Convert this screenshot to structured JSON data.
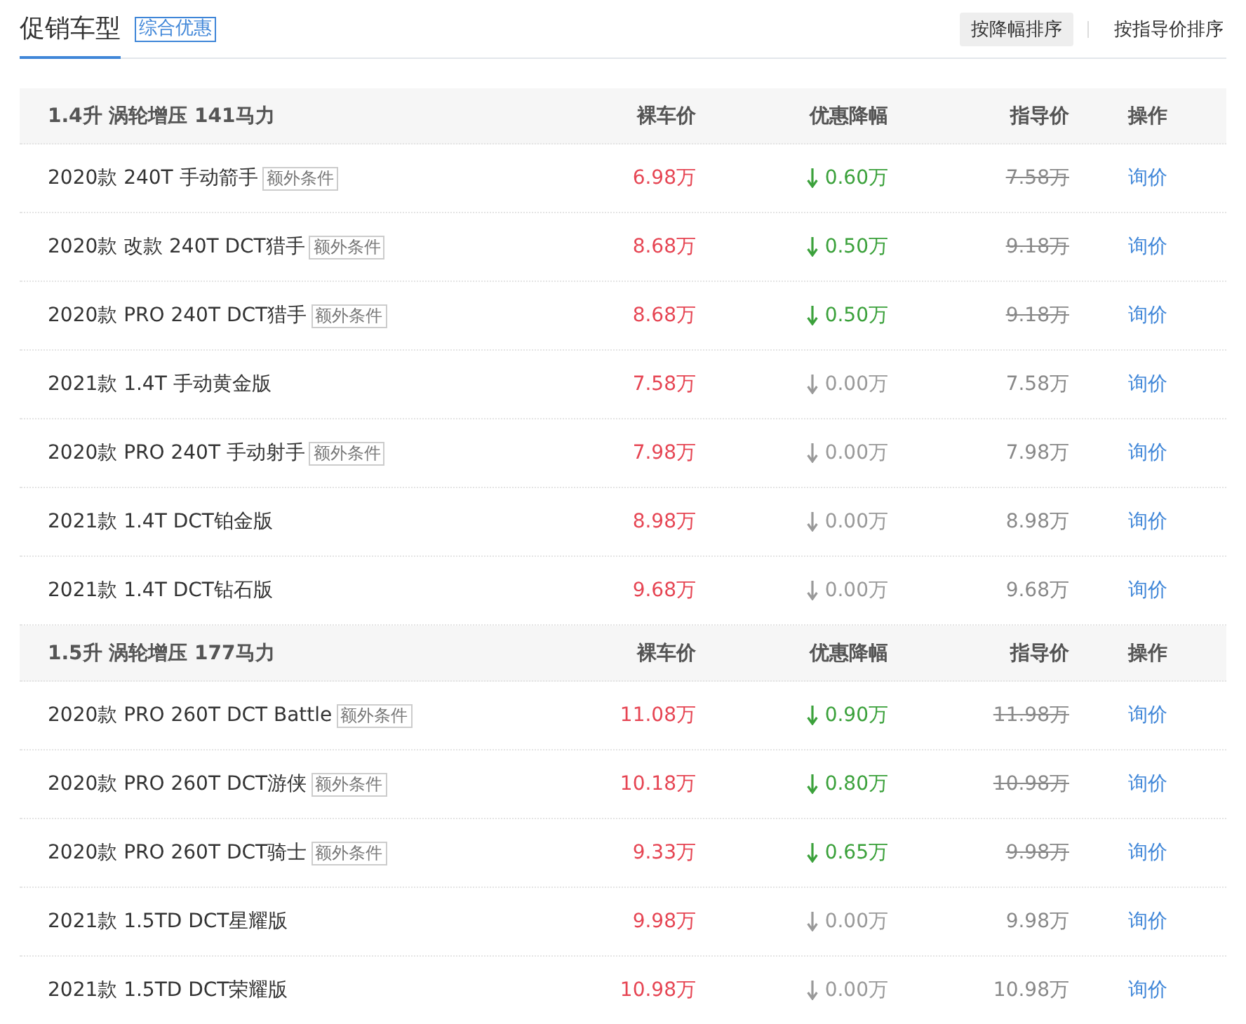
{
  "header": {
    "tabs": [
      {
        "label": "促销车型",
        "selected": true
      }
    ],
    "badge": "综合优惠",
    "sort_buttons": [
      {
        "label": "按降幅排序",
        "selected": true
      },
      {
        "label": "按指导价排序",
        "selected": false
      }
    ]
  },
  "groups": [
    {
      "title": "1.4升 涡轮增压 141马力",
      "columns": [
        "裸车价",
        "优惠降幅",
        "指导价",
        "操作"
      ],
      "rows": [
        {
          "name": "2020款 240T 手动箭手",
          "tag": "额外条件",
          "price": "6.98万",
          "discount": "0.60万",
          "discounted": true,
          "guide": "7.58万",
          "action": "询价"
        },
        {
          "name": "2020款 改款 240T DCT猎手",
          "tag": "额外条件",
          "price": "8.68万",
          "discount": "0.50万",
          "discounted": true,
          "guide": "9.18万",
          "action": "询价"
        },
        {
          "name": "2020款 PRO 240T DCT猎手",
          "tag": "额外条件",
          "price": "8.68万",
          "discount": "0.50万",
          "discounted": true,
          "guide": "9.18万",
          "action": "询价"
        },
        {
          "name": "2021款 1.4T 手动黄金版",
          "price": "7.58万",
          "discount": "0.00万",
          "discounted": false,
          "guide": "7.58万",
          "action": "询价"
        },
        {
          "name": "2020款 PRO 240T 手动射手",
          "tag": "额外条件",
          "price": "7.98万",
          "discount": "0.00万",
          "discounted": false,
          "guide": "7.98万",
          "action": "询价"
        },
        {
          "name": "2021款 1.4T DCT铂金版",
          "price": "8.98万",
          "discount": "0.00万",
          "discounted": false,
          "guide": "8.98万",
          "action": "询价"
        },
        {
          "name": "2021款 1.4T DCT钻石版",
          "price": "9.68万",
          "discount": "0.00万",
          "discounted": false,
          "guide": "9.68万",
          "action": "询价"
        }
      ]
    },
    {
      "title": "1.5升 涡轮增压 177马力",
      "columns": [
        "裸车价",
        "优惠降幅",
        "指导价",
        "操作"
      ],
      "rows": [
        {
          "name": "2020款 PRO 260T DCT Battle",
          "tag": "额外条件",
          "price": "11.08万",
          "discount": "0.90万",
          "discounted": true,
          "guide": "11.98万",
          "action": "询价"
        },
        {
          "name": "2020款 PRO 260T DCT游侠",
          "tag": "额外条件",
          "price": "10.18万",
          "discount": "0.80万",
          "discounted": true,
          "guide": "10.98万",
          "action": "询价"
        },
        {
          "name": "2020款 PRO 260T DCT骑士",
          "tag": "额外条件",
          "price": "9.33万",
          "discount": "0.65万",
          "discounted": true,
          "guide": "9.98万",
          "action": "询价"
        },
        {
          "name": "2021款 1.5TD DCT星耀版",
          "price": "9.98万",
          "discount": "0.00万",
          "discounted": false,
          "guide": "9.98万",
          "action": "询价"
        },
        {
          "name": "2021款 1.5TD DCT荣耀版",
          "price": "10.98万",
          "discount": "0.00万",
          "discounted": false,
          "guide": "10.98万",
          "action": "询价"
        }
      ]
    }
  ]
}
